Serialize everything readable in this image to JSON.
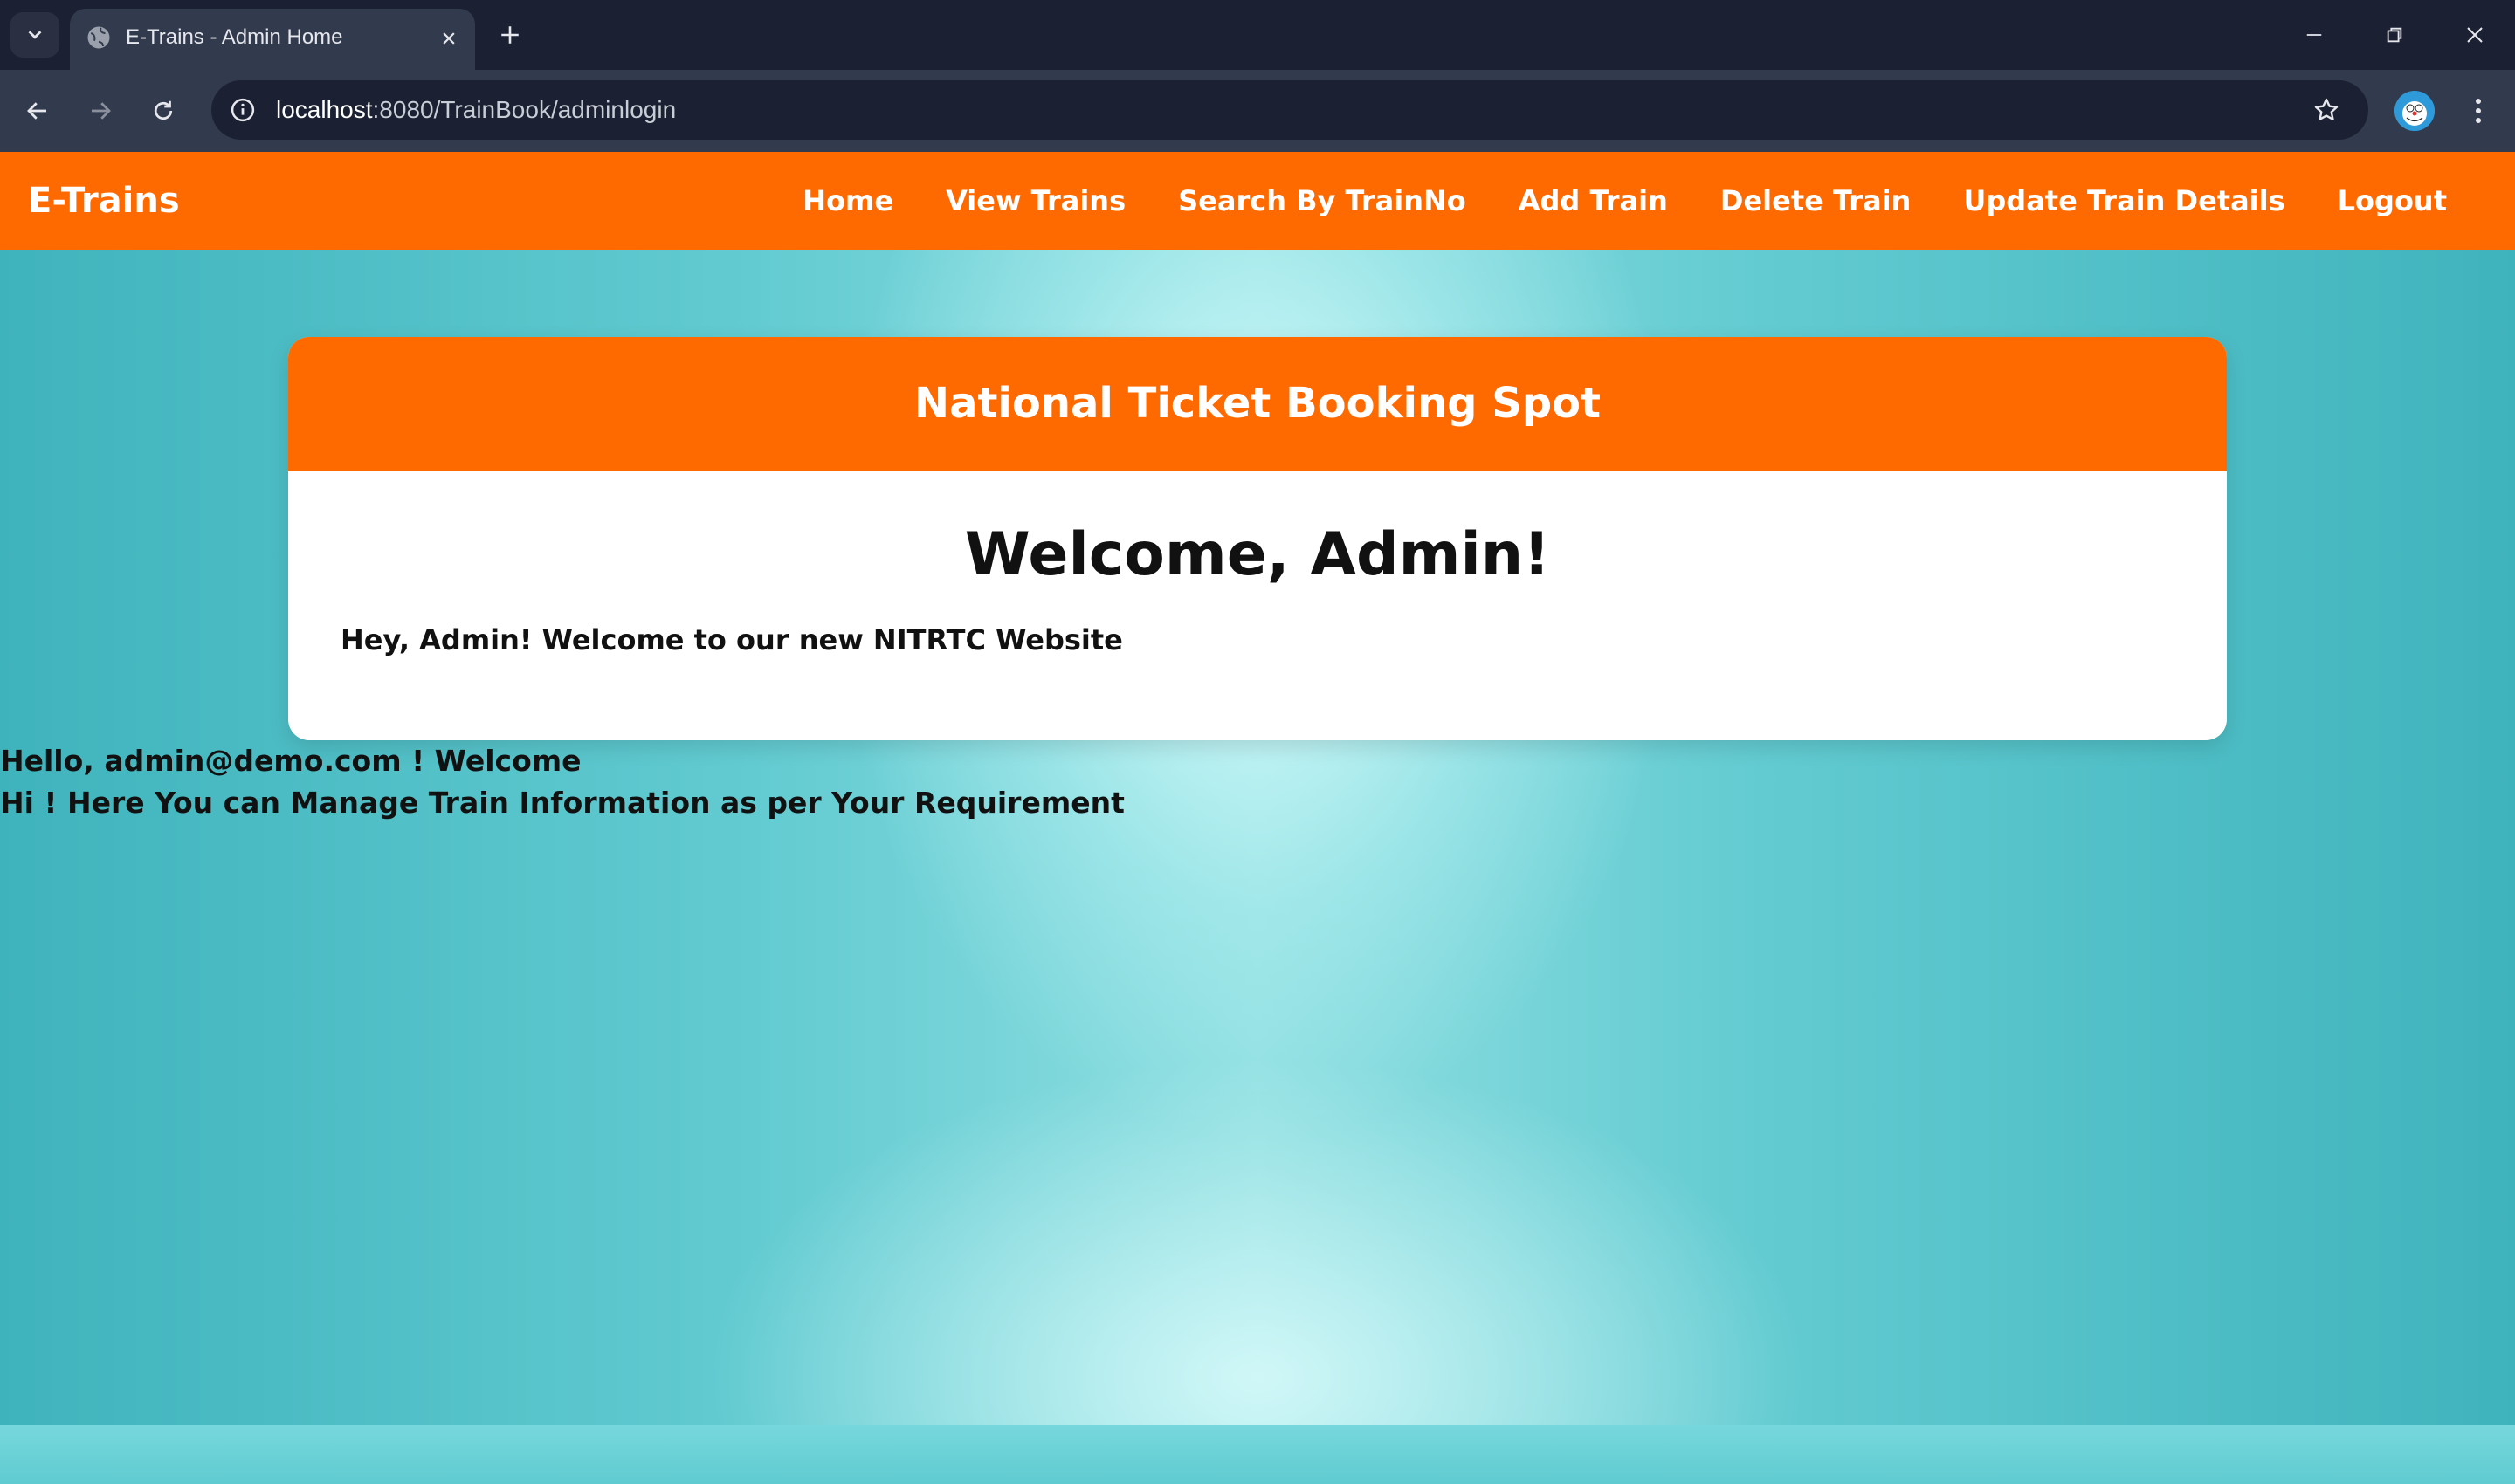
{
  "browser": {
    "tab_title": "E-Trains - Admin Home",
    "url_host": "localhost",
    "url_rest": ":8080/TrainBook/adminlogin"
  },
  "site": {
    "brand": "E-Trains",
    "nav": [
      {
        "label": "Home"
      },
      {
        "label": "View Trains"
      },
      {
        "label": "Search By TrainNo"
      },
      {
        "label": "Add Train"
      },
      {
        "label": "Delete Train"
      },
      {
        "label": "Update Train Details"
      },
      {
        "label": "Logout"
      }
    ],
    "accent_color": "#ff6a00"
  },
  "card": {
    "header": "National Ticket Booking Spot",
    "title": "Welcome, Admin!",
    "text": "Hey, Admin! Welcome to our new NITRTC Website"
  },
  "messages": {
    "hello": "Hello, admin@demo.com ! Welcome",
    "hint": "Hi ! Here You can Manage Train Information as per Your Requirement"
  },
  "icons": [
    "chevron-down-icon",
    "globe-icon",
    "close-icon",
    "plus-icon",
    "minimize-icon",
    "restore-icon",
    "back-icon",
    "forward-icon",
    "reload-icon",
    "site-info-icon",
    "star-icon",
    "profile-avatar",
    "kebab-menu-icon"
  ]
}
